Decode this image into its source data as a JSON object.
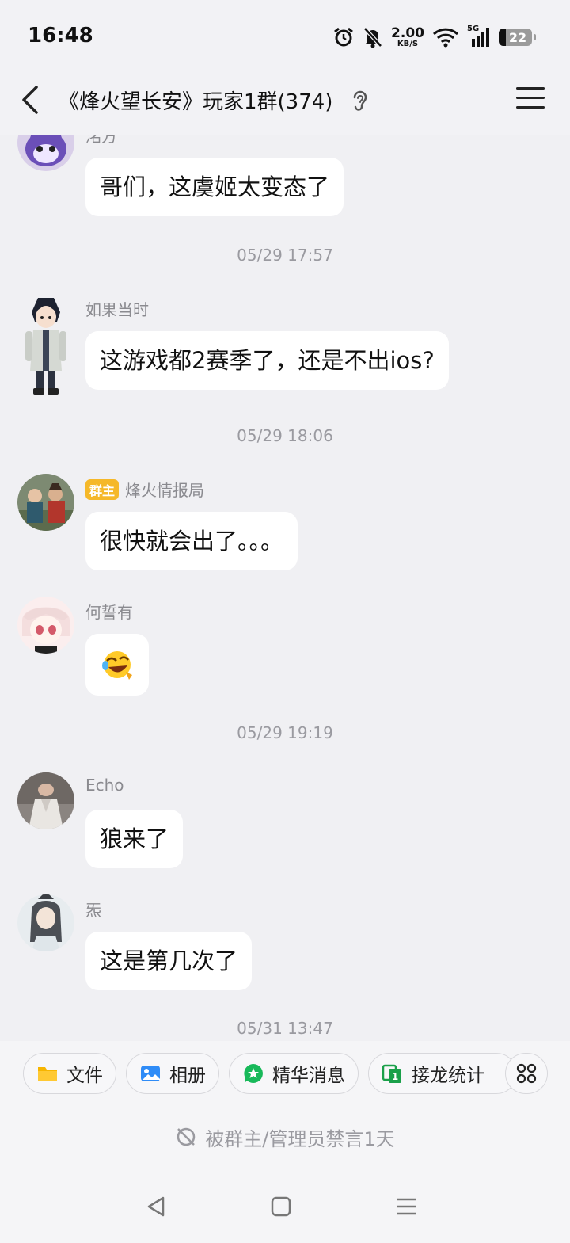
{
  "status_bar": {
    "time": "16:48",
    "net_speed": "2.00",
    "net_unit": "KB/S",
    "signal": "5G",
    "battery": "22"
  },
  "header": {
    "title": "《烽火望长安》玩家1群(374)"
  },
  "chat": {
    "items": [
      {
        "sender": "洺方",
        "text": "哥们，这虞姬太变态了"
      },
      {
        "timestamp": "05/29 17:57"
      },
      {
        "sender": "如果当时",
        "text": "这游戏都2赛季了，还是不出ios?"
      },
      {
        "timestamp": "05/29 18:06"
      },
      {
        "badge": "群主",
        "sender": "烽火情报局",
        "text": "很快就会出了。。。"
      },
      {
        "sender": "何誓有",
        "emoji": "😂"
      },
      {
        "timestamp": "05/29 19:19"
      },
      {
        "sender": "Echo",
        "text": "狼来了"
      },
      {
        "sender": "炁",
        "text": "这是第几次了"
      },
      {
        "timestamp": "05/31 13:47"
      }
    ]
  },
  "toolbar": {
    "items": [
      "文件",
      "相册",
      "精华消息",
      "接龙统计"
    ]
  },
  "muted_notice": "被群主/管理员禁言1天",
  "colors": {
    "accent_badge": "#f5b829",
    "file_icon": "#f7b500",
    "album_icon": "#2f8cf7",
    "essence_icon": "#18b95a",
    "relay_icon": "#1aa04a"
  }
}
